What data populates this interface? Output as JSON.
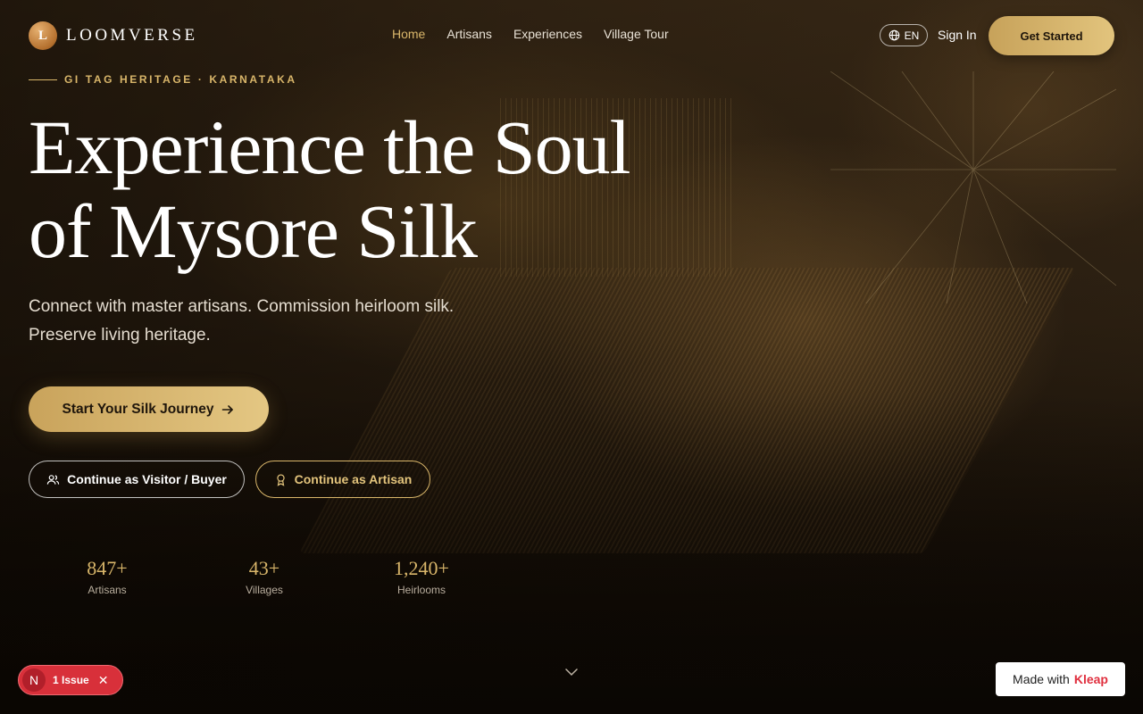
{
  "brand": {
    "mark": "L",
    "name": "LOOMVERSE"
  },
  "nav": {
    "links": [
      {
        "label": "Home",
        "active": true
      },
      {
        "label": "Artisans",
        "active": false
      },
      {
        "label": "Experiences",
        "active": false
      },
      {
        "label": "Village Tour",
        "active": false
      }
    ],
    "language": "EN",
    "sign_in": "Sign In",
    "get_started": "Get Started"
  },
  "hero": {
    "eyebrow": "GI TAG HERITAGE · KARNATAKA",
    "title_line1": "Experience the Soul",
    "title_line2": "of Mysore Silk",
    "subtitle_line1": "Connect with master artisans. Commission heirloom silk.",
    "subtitle_line2": "Preserve living heritage.",
    "primary_cta": "Start Your Silk Journey",
    "visitor_cta": "Continue as Visitor / Buyer",
    "artisan_cta": "Continue as Artisan"
  },
  "stats": [
    {
      "value": "847+",
      "label": "Artisans"
    },
    {
      "value": "43+",
      "label": "Villages"
    },
    {
      "value": "1,240+",
      "label": "Heirlooms"
    }
  ],
  "dev_overlay": {
    "issue_badge": "N",
    "issue_label": "1 Issue",
    "close": "✕"
  },
  "made_with": {
    "prefix": "Made with",
    "brand": "Kleap"
  },
  "colors": {
    "gold": "#d9b66a",
    "cta_gradient_start": "#c9a35b",
    "cta_gradient_end": "#e4c783",
    "issue_red": "#d8303a"
  }
}
